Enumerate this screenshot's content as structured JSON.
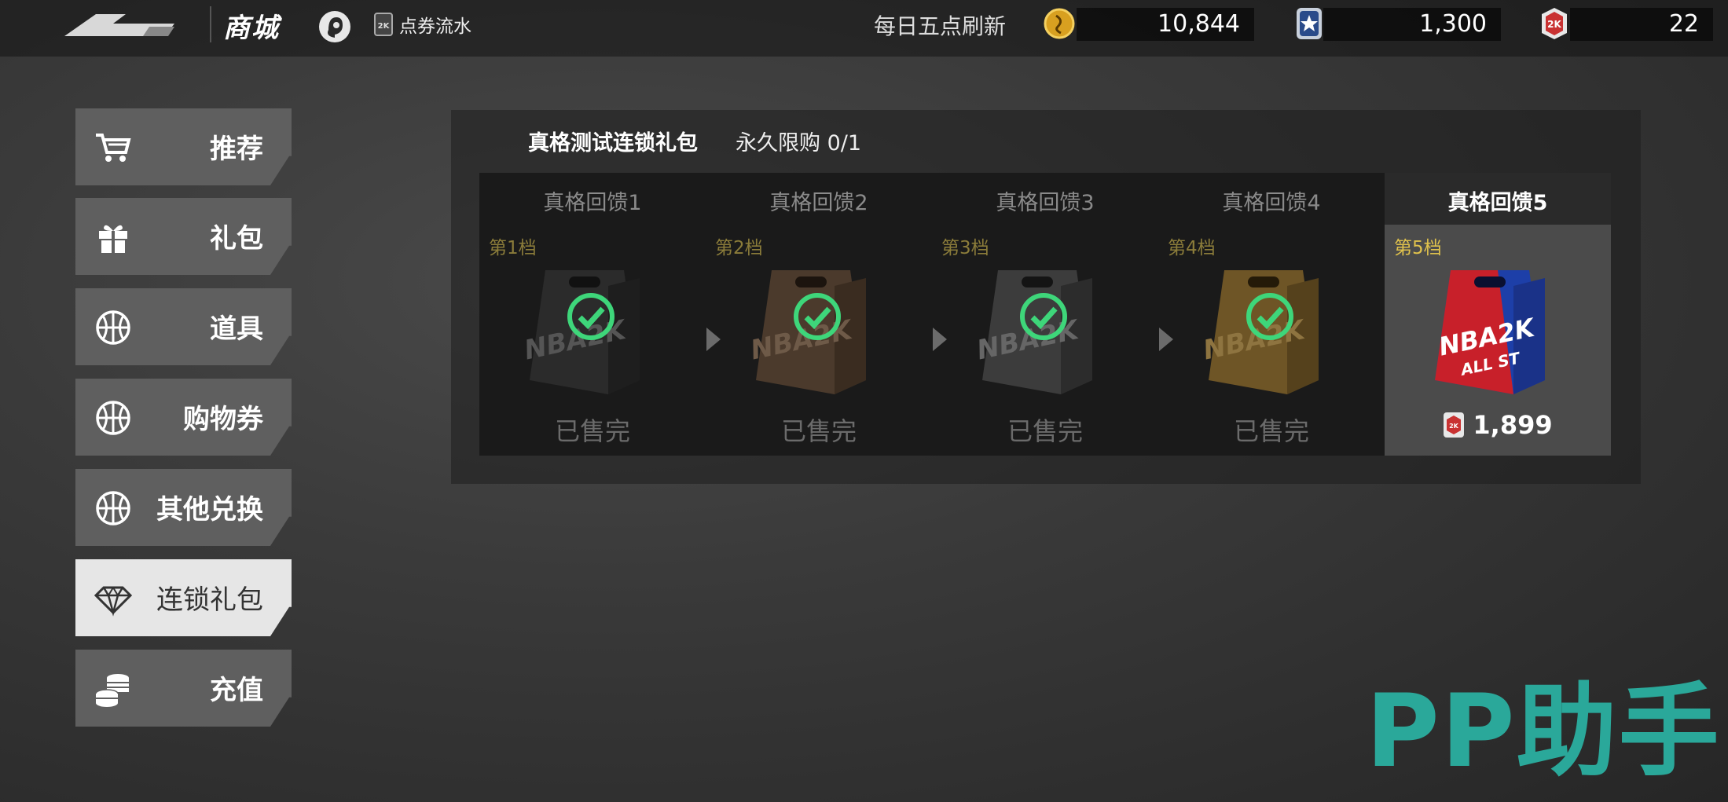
{
  "topbar": {
    "title": "商城",
    "ledger_label": "点券流水",
    "refresh_text": "每日五点刷新",
    "currencies": [
      {
        "icon": "gold-coin-icon",
        "value": "10,844"
      },
      {
        "icon": "star-badge-icon",
        "value": "1,300"
      },
      {
        "icon": "2k-coupon-icon",
        "value": "22"
      }
    ]
  },
  "sidebar": {
    "items": [
      {
        "label": "推荐",
        "icon": "cart-icon",
        "active": false
      },
      {
        "label": "礼包",
        "icon": "gift-icon",
        "active": false
      },
      {
        "label": "道具",
        "icon": "basketball-icon",
        "active": false
      },
      {
        "label": "购物券",
        "icon": "basketball-icon",
        "active": false
      },
      {
        "label": "其他兑换",
        "icon": "basketball-icon",
        "active": false
      },
      {
        "label": "连锁礼包",
        "icon": "diamond-icon",
        "active": true
      },
      {
        "label": "充值",
        "icon": "coins-icon",
        "active": false
      }
    ]
  },
  "pack": {
    "title": "真格测试连锁礼包",
    "limit": "永久限购 0/1",
    "tiers": [
      {
        "name": "真格回馈1",
        "grade": "第1档",
        "status": "已售完",
        "color": "#2b2b2b"
      },
      {
        "name": "真格回馈2",
        "grade": "第2档",
        "status": "已售完",
        "color": "#4b3a2c"
      },
      {
        "name": "真格回馈3",
        "grade": "第3档",
        "status": "已售完",
        "color": "#3c3c3c"
      },
      {
        "name": "真格回馈4",
        "grade": "第4档",
        "status": "已售完",
        "color": "#6e5526"
      },
      {
        "name": "真格回馈5",
        "grade": "第5档",
        "price": "1,899",
        "bag_text": "NBA2K",
        "bag_sub": "ALL ST"
      }
    ]
  },
  "watermark": "PP助手"
}
